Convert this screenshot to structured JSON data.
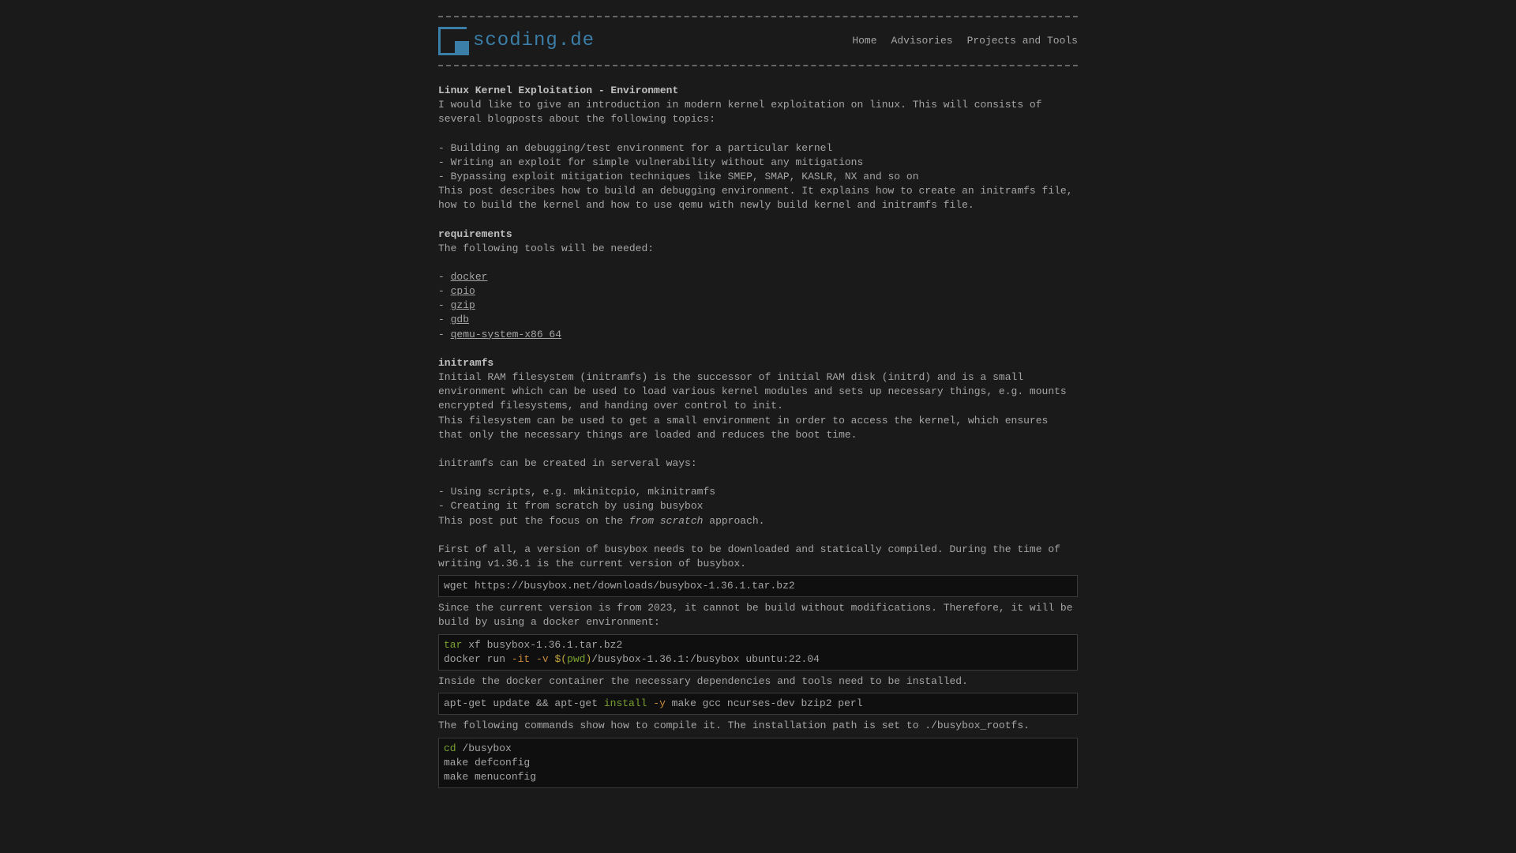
{
  "logo": {
    "text": "scoding.de"
  },
  "nav": {
    "home": "Home",
    "advisories": "Advisories",
    "projects": "Projects and Tools"
  },
  "article": {
    "title": "Linux Kernel Exploitation - Environment",
    "intro": "I would like to give an introduction in modern kernel exploitation on linux. This will consists of several blogposts about the following topics:",
    "topics": [
      "- Building an debugging/test environment for a particular kernel",
      "- Writing an exploit for simple vulnerability without any mitigations",
      "- Bypassing exploit mitigation techniques like SMEP, SMAP, KASLR, NX and so on"
    ],
    "intro_post": "This post describes how to build an debugging environment. It explains how to create an initramfs file, how to build the kernel and how to use qemu with newly build kernel and initramfs file.",
    "req_heading": "requirements",
    "req_intro": "The following tools will be needed:",
    "req_items": {
      "docker": "docker",
      "cpio": "cpio",
      "gzip": "gzip",
      "gdb": "gdb",
      "qemu": "qemu-system-x86_64"
    },
    "initramfs_heading": "initramfs",
    "initramfs_p1": "Initial RAM filesystem (initramfs) is the successor of initial RAM disk (initrd) and is a small environment which can be used to load various kernel modules and sets up necessary things, e.g. mounts encrypted filesystems, and handing over control to init.",
    "initramfs_p2": "This filesystem can be used to get a small environment in order to access the kernel, which ensures that only the necessary things are loaded and reduces the boot time.",
    "initramfs_p3": "initramfs can be created in serveral ways:",
    "initramfs_ways": [
      "- Using scripts, e.g. mkinitcpio, mkinitramfs",
      "- Creating it from scratch by using busybox"
    ],
    "focus_pre": "This post put the focus on the ",
    "focus_italic": "from scratch",
    "focus_post": " approach.",
    "busybox_p": "First of all, a version of busybox needs to be downloaded and statically compiled. During the time of writing v1.36.1 is the current version of busybox.",
    "code1": "wget https://busybox.net/downloads/busybox-1.36.1.tar.bz2",
    "docker_p": "Since the current version is from 2023, it cannot be build without modifications. Therefore, it will be build by using a docker environment:",
    "code2": {
      "tar": "tar",
      "tar_rest": " xf busybox-1.36.1.tar.bz2",
      "docker_pre": "docker run ",
      "it": "-it",
      "space": " ",
      "v": "-v",
      "dollar_open": " $(",
      "pwd": "pwd",
      "close": ")",
      "rest": "/busybox-1.36.1:/busybox ubuntu:22.04"
    },
    "inside_p": "Inside the docker container the necessary dependencies and tools need to be installed.",
    "code3": {
      "pre": "apt-get update && apt-get ",
      "install": "install",
      "space": " ",
      "y": "-y",
      "rest": " make gcc ncurses-dev bzip2 perl"
    },
    "compile_p": "The following commands show how to compile it. The installation path is set to ./busybox_rootfs.",
    "code4": {
      "cd": "cd",
      "cd_rest": " /busybox",
      "l2": "make defconfig",
      "l3": "make menuconfig"
    }
  }
}
